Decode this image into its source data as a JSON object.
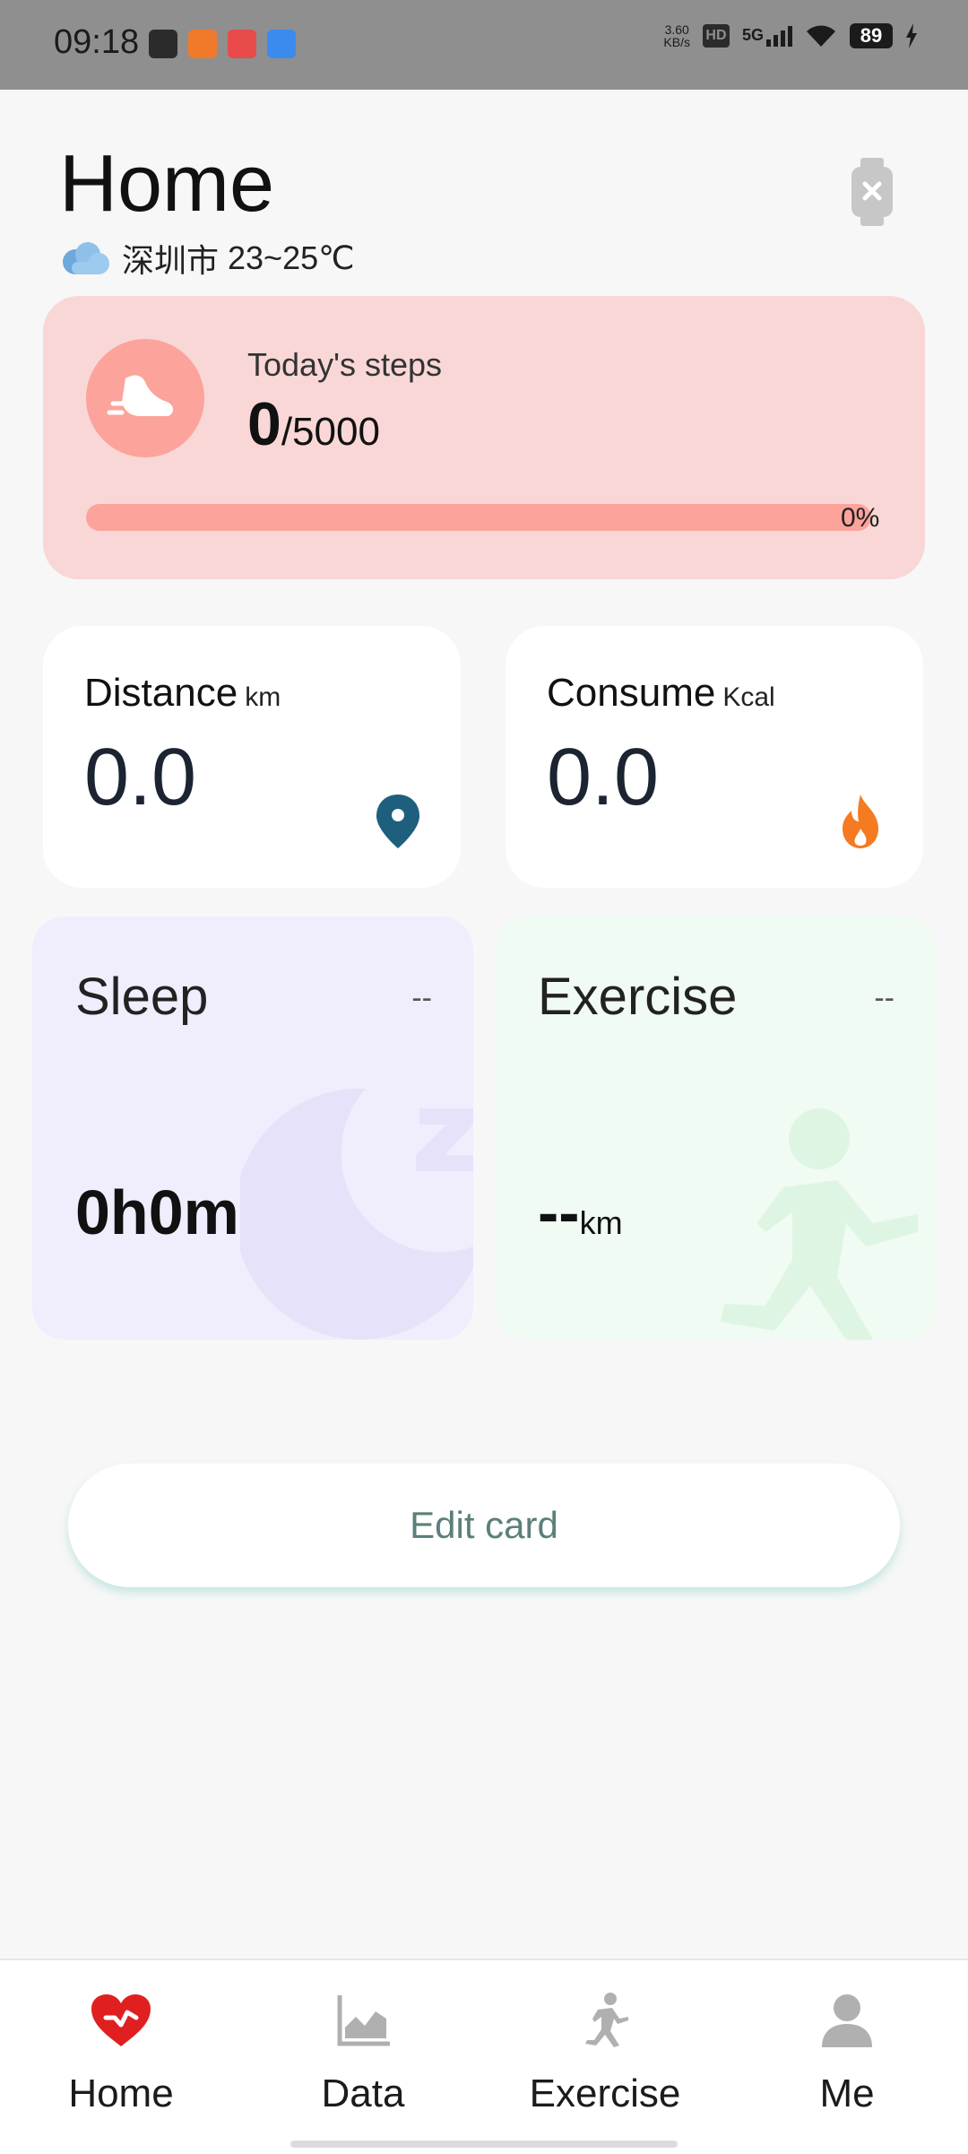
{
  "status_bar": {
    "time": "09:18",
    "net_speed_value": "3.60",
    "net_speed_unit": "KB/s",
    "hd_label": "HD",
    "network_label": "5G",
    "battery_level": "89"
  },
  "header": {
    "title": "Home",
    "weather_city": "深圳市",
    "weather_temp": "23~25℃"
  },
  "steps": {
    "label": "Today's steps",
    "value": "0",
    "goal": "/5000",
    "progress_percent_label": "0%",
    "progress_fraction": 0
  },
  "distance": {
    "label": "Distance",
    "unit": "km",
    "value": "0.0"
  },
  "consume": {
    "label": "Consume",
    "unit": "Kcal",
    "value": "0.0"
  },
  "sleep": {
    "title": "Sleep",
    "dash": "--",
    "value": "0h0m"
  },
  "exercise": {
    "title": "Exercise",
    "dash": "--",
    "value": "--",
    "unit": "km"
  },
  "edit_button": {
    "label": "Edit card"
  },
  "nav": {
    "items": [
      {
        "label": "Home",
        "icon": "heart-pulse-icon",
        "active": true
      },
      {
        "label": "Data",
        "icon": "chart-icon",
        "active": false
      },
      {
        "label": "Exercise",
        "icon": "runner-icon",
        "active": false
      },
      {
        "label": "Me",
        "icon": "person-icon",
        "active": false
      }
    ]
  },
  "colors": {
    "steps_card_bg": "#f8d7d6",
    "steps_accent": "#fca39c",
    "location_pin": "#1e5f7e",
    "flame": "#f47b20",
    "sleep_bg": "#f0eefd",
    "exercise_bg": "#f0fbf3",
    "nav_active": "#e02020"
  }
}
